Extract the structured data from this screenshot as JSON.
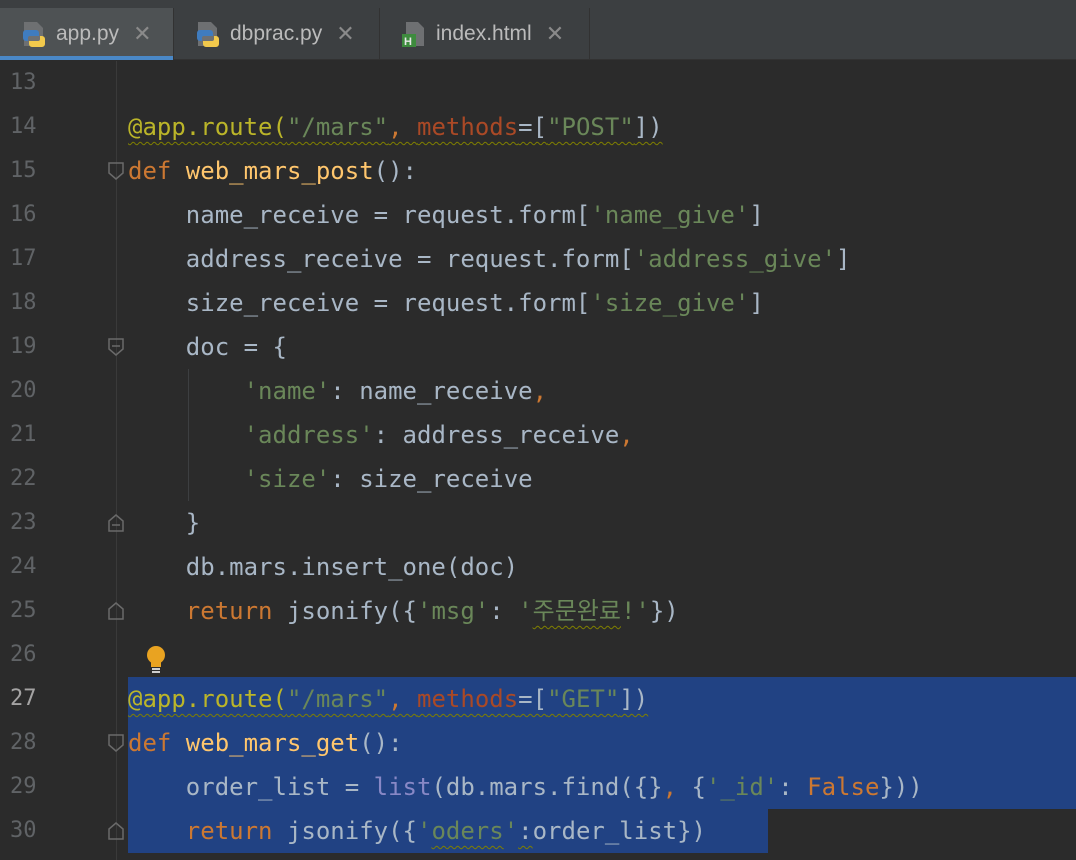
{
  "tabs": [
    {
      "label": "app.py",
      "active": true,
      "icon": "python-file-icon"
    },
    {
      "label": "dbprac.py",
      "active": false,
      "icon": "python-file-icon"
    },
    {
      "label": "index.html",
      "active": false,
      "icon": "html-file-icon"
    }
  ],
  "close_glyph": "✕",
  "gutter": {
    "line_numbers": [
      "13",
      "14",
      "15",
      "16",
      "17",
      "18",
      "19",
      "20",
      "21",
      "22",
      "23",
      "24",
      "25",
      "26",
      "27",
      "28",
      "29",
      "30"
    ],
    "current_line": "27"
  },
  "code": {
    "l14": {
      "t1": "@app.route(",
      "t2": "\"/mars\"",
      "t3": ", ",
      "t4": "methods",
      "t5": "=[",
      "t6": "\"POST\"",
      "t7": "])"
    },
    "l15": {
      "t1": "def ",
      "t2": "web_mars_post",
      "t3": "():"
    },
    "l16": {
      "t1": "    name_receive = request.form[",
      "t2": "'name_give'",
      "t3": "]"
    },
    "l17": {
      "t1": "    address_receive = request.form[",
      "t2": "'address_give'",
      "t3": "]"
    },
    "l18": {
      "t1": "    size_receive = request.form[",
      "t2": "'size_give'",
      "t3": "]"
    },
    "l19": {
      "t1": "    doc = {"
    },
    "l20": {
      "t1": "        ",
      "t2": "'name'",
      "t3": ": name_receive",
      "t4": ","
    },
    "l21": {
      "t1": "        ",
      "t2": "'address'",
      "t3": ": address_receive",
      "t4": ","
    },
    "l22": {
      "t1": "        ",
      "t2": "'size'",
      "t3": ": size_receive"
    },
    "l23": {
      "t1": "    }"
    },
    "l24": {
      "t1": "    db.mars.insert_one(doc)"
    },
    "l25": {
      "t1": "    ",
      "t2": "return",
      "t3": " jsonify({",
      "t4": "'msg'",
      "t5": ": ",
      "t6": "'",
      "t7": "주문완료",
      "t8": "!'",
      "t9": "})"
    },
    "l27": {
      "t1": "@app.route(",
      "t2": "\"/mars\"",
      "t3": ", ",
      "t4": "methods",
      "t5": "=[",
      "t6": "\"GET\"",
      "t7": "])"
    },
    "l28": {
      "t1": "def ",
      "t2": "web_mars_get",
      "t3": "():"
    },
    "l29": {
      "t1": "    order_list = ",
      "t2": "list",
      "t3": "(db.mars.find({}",
      "t4": ", ",
      "t5": "{",
      "t6": "'_id'",
      "t7": ": ",
      "t8": "False",
      "t9": "}))"
    },
    "l30": {
      "t1": "    ",
      "t2": "return",
      "t3": " jsonify({",
      "t4": "'",
      "t5": "oders",
      "t6": "'",
      "t7": ":",
      "t8": "order_list})"
    }
  },
  "colors": {
    "background": "#2b2b2b",
    "selection": "#214283",
    "keyword": "#cc7832",
    "string": "#6a8759",
    "decorator": "#bbb529",
    "function": "#ffc66d",
    "param": "#aa4926",
    "builtin": "#8888c6",
    "tab_accent": "#4a88c7"
  },
  "intention_icon": "lightbulb-icon"
}
